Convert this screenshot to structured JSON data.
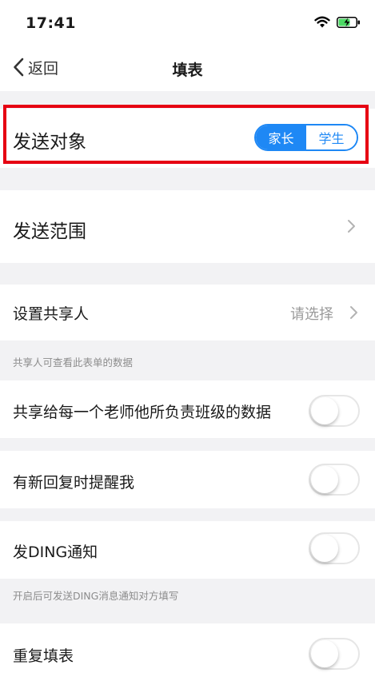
{
  "status_bar": {
    "time": "17:41",
    "wifi_icon": "wifi-icon",
    "battery_icon": "battery-charging-icon"
  },
  "nav": {
    "back_label": "返回",
    "title": "填表"
  },
  "send_target": {
    "label": "发送对象",
    "options": [
      "家长",
      "学生"
    ],
    "selected": "家长"
  },
  "send_scope": {
    "label": "发送范围"
  },
  "share": {
    "label": "设置共享人",
    "value": "请选择",
    "note": "共享人可查看此表单的数据"
  },
  "toggles": [
    {
      "label": "共享给每一个老师他所负责班级的数据",
      "on": false
    },
    {
      "label": "有新回复时提醒我",
      "on": false
    },
    {
      "label": "发DING通知",
      "on": false,
      "note": "开启后可发送DING消息通知对方填写"
    },
    {
      "label": "重复填表",
      "on": false
    }
  ],
  "colors": {
    "accent": "#1e88f5",
    "highlight": "#e60012",
    "background": "#f2f2f4"
  }
}
